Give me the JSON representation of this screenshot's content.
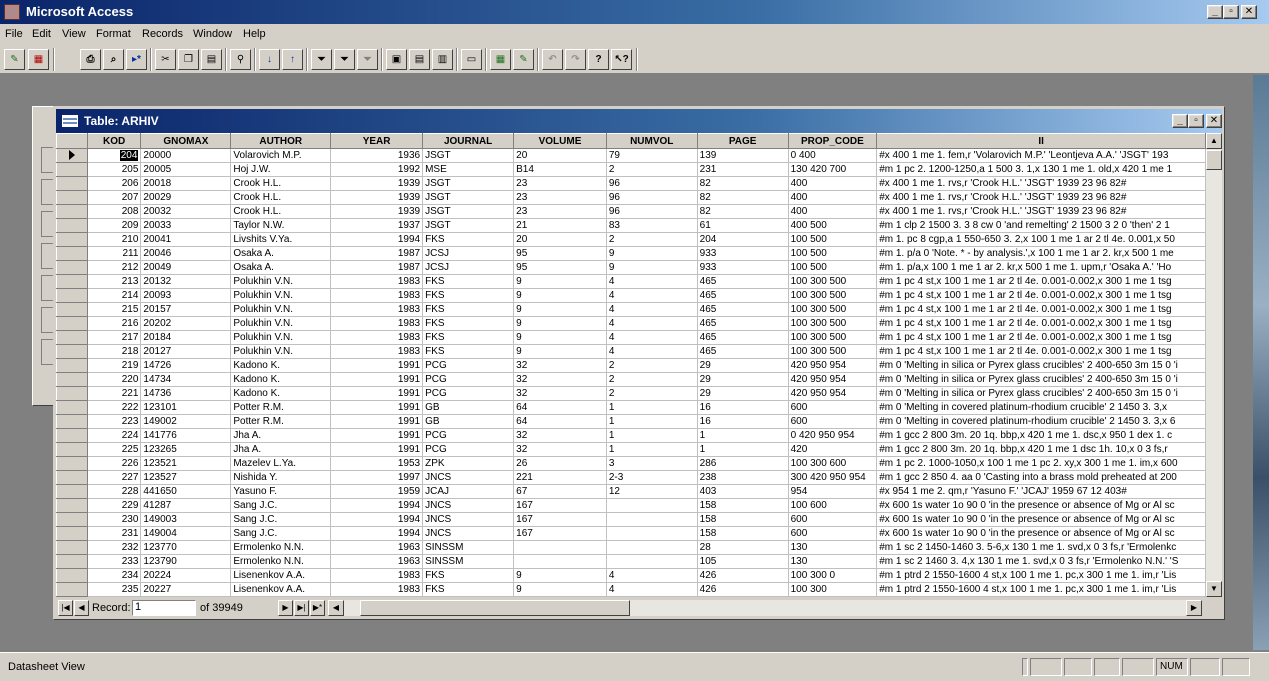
{
  "app": {
    "title": "Microsoft Access"
  },
  "menu": [
    "File",
    "Edit",
    "View",
    "Format",
    "Records",
    "Window",
    "Help"
  ],
  "toolbar_icons": [
    "design-view-icon",
    "datasheet-view-icon",
    "print-icon",
    "print-preview-icon",
    "spelling-icon",
    "cut-icon",
    "copy-icon",
    "paste-icon",
    "find-icon",
    "sort-ascending-icon",
    "sort-descending-icon",
    "filter-by-selection-icon",
    "filter-by-form-icon",
    "apply-filter-icon",
    "new-record-icon",
    "delete-record-icon",
    "properties-icon",
    "database-window-icon",
    "new-object-icon",
    "office-links-icon",
    "undo-icon",
    "help-icon",
    "whats-this-icon"
  ],
  "table_window": {
    "title": "Table: ARHIV",
    "columns": [
      "KOD",
      "GNOMAX",
      "AUTHOR",
      "YEAR",
      "JOURNAL",
      "VOLUME",
      "NUMVOL",
      "PAGE",
      "PROP_CODE",
      "II"
    ],
    "rows": [
      [
        "204",
        "20000",
        "Volarovich M.P.",
        "1936",
        "JSGT",
        "20",
        "79",
        "139",
        "0 400",
        "#x 400 1 me 1. fem,r 'Volarovich M.P.' 'Leontjeva A.A.'  'JSGT'  193"
      ],
      [
        "205",
        "20005",
        "Hoj J.W.",
        "1992",
        "MSE",
        "B14",
        "2",
        "231",
        "130 420 700",
        "#m 1 pc 2. 1200-1250,a 1 500 3. 1,x 130 1 me 1. old,x 420 1 me 1"
      ],
      [
        "206",
        "20018",
        "Crook H.L.",
        "1939",
        "JSGT",
        "23",
        "96",
        "82",
        "400",
        "#x 400 1 me 1. rvs,r 'Crook H.L.'  'JSGT'  1939 23 96 82#"
      ],
      [
        "207",
        "20029",
        "Crook H.L.",
        "1939",
        "JSGT",
        "23",
        "96",
        "82",
        "400",
        "#x 400 1 me 1. rvs,r 'Crook H.L.'  'JSGT'  1939 23 96 82#"
      ],
      [
        "208",
        "20032",
        "Crook H.L.",
        "1939",
        "JSGT",
        "23",
        "96",
        "82",
        "400",
        "#x 400 1 me 1. rvs,r 'Crook H.L.'  'JSGT'  1939 23 96 82#"
      ],
      [
        "209",
        "20033",
        "Taylor N.W.",
        "1937",
        "JSGT",
        "21",
        "83",
        "61",
        "400 500",
        "#m 1 clp 2 1500 3. 3 8 cw 0 'and remelting' 2 1500 3 2 0 'then' 2 1"
      ],
      [
        "210",
        "20041",
        "Livshits V.Ya.",
        "1994",
        "FKS",
        "20",
        "2",
        "204",
        "100 500",
        "#m 1. pc 8 cgp,a 1 550-650 3. 2,x 100 1 me 1 ar 2 tl 4e. 0.001,x 50"
      ],
      [
        "211",
        "20046",
        "Osaka A.",
        "1987",
        "JCSJ",
        "95",
        "9",
        "933",
        "100 500",
        "#m 1. p/a 0 'Note. * - by analysis.',x 100 1 me 1 ar 2. kr,x 500 1 me"
      ],
      [
        "212",
        "20049",
        "Osaka A.",
        "1987",
        "JCSJ",
        "95",
        "9",
        "933",
        "100 500",
        "#m 1. p/a,x 100 1 me 1 ar 2. kr,x 500 1 me 1. upm,r 'Osaka A.' 'Ho"
      ],
      [
        "213",
        "20132",
        "Polukhin V.N.",
        "1983",
        "FKS",
        "9",
        "4",
        "465",
        "100 300 500",
        "#m 1 pc 4 st,x 100 1 me 1 ar 2 tl 4e. 0.001-0.002,x 300 1 me 1 tsg"
      ],
      [
        "214",
        "20093",
        "Polukhin V.N.",
        "1983",
        "FKS",
        "9",
        "4",
        "465",
        "100 300 500",
        "#m 1 pc 4 st,x 100 1 me 1 ar 2 tl 4e. 0.001-0.002,x 300 1 me 1 tsg"
      ],
      [
        "215",
        "20157",
        "Polukhin V.N.",
        "1983",
        "FKS",
        "9",
        "4",
        "465",
        "100 300 500",
        "#m 1 pc 4 st,x 100 1 me 1 ar 2 tl 4e. 0.001-0.002,x 300 1 me 1 tsg"
      ],
      [
        "216",
        "20202",
        "Polukhin V.N.",
        "1983",
        "FKS",
        "9",
        "4",
        "465",
        "100 300 500",
        "#m 1 pc 4 st,x 100 1 me 1 ar 2 tl 4e. 0.001-0.002,x 300 1 me 1 tsg"
      ],
      [
        "217",
        "20184",
        "Polukhin V.N.",
        "1983",
        "FKS",
        "9",
        "4",
        "465",
        "100 300 500",
        "#m 1 pc 4 st,x 100 1 me 1 ar 2 tl 4e. 0.001-0.002,x 300 1 me 1 tsg"
      ],
      [
        "218",
        "20127",
        "Polukhin V.N.",
        "1983",
        "FKS",
        "9",
        "4",
        "465",
        "100 300 500",
        "#m 1 pc 4 st,x 100 1 me 1 ar 2 tl 4e. 0.001-0.002,x 300 1 me 1 tsg"
      ],
      [
        "219",
        "14726",
        "Kadono K.",
        "1991",
        "PCG",
        "32",
        "2",
        "29",
        "420 950 954",
        "#m 0 'Melting in silica or Pyrex glass crucibles' 2 400-650 3m 15 0 'i"
      ],
      [
        "220",
        "14734",
        "Kadono K.",
        "1991",
        "PCG",
        "32",
        "2",
        "29",
        "420 950 954",
        "#m 0 'Melting in silica or Pyrex glass crucibles' 2 400-650 3m 15 0 'i"
      ],
      [
        "221",
        "14736",
        "Kadono K.",
        "1991",
        "PCG",
        "32",
        "2",
        "29",
        "420 950 954",
        "#m 0 'Melting in silica or Pyrex glass crucibles' 2 400-650 3m 15 0 'i"
      ],
      [
        "222",
        "123101",
        "Potter R.M.",
        "1991",
        "GB",
        "64",
        "1",
        "16",
        "600",
        "#m 0 'Melting in covered platinum-rhodium crucible' 2 1450 3. 3,x"
      ],
      [
        "223",
        "149002",
        "Potter R.M.",
        "1991",
        "GB",
        "64",
        "1",
        "16",
        "600",
        "#m 0 'Melting in covered platinum-rhodium crucible' 2 1450 3. 3,x 6"
      ],
      [
        "224",
        "141776",
        "Jha A.",
        "1991",
        "PCG",
        "32",
        "1",
        "1",
        "0 420 950 954",
        "#m 1 gcc 2 800 3m. 20 1q. bbp,x 420 1 me 1.  dsc,x 950 1 dex 1. c"
      ],
      [
        "225",
        "123265",
        "Jha A.",
        "1991",
        "PCG",
        "32",
        "1",
        "1",
        "420",
        "#m 1 gcc 2 800 3m. 20 1q. bbp,x 420 1 me 1  dsc 1h. 10,x 0 3 fs,r"
      ],
      [
        "226",
        "123521",
        "Mazelev L.Ya.",
        "1953",
        "ZPK",
        "26",
        "3",
        "286",
        "100 300 600",
        "#m 1 pc 2. 1000-1050,x 100 1 me 1 pc 2. xy,x 300 1 me 1. im,x 600"
      ],
      [
        "227",
        "123527",
        "Nishida Y.",
        "1997",
        "JNCS",
        "221",
        "2-3",
        "238",
        "300 420 950 954",
        "#m 1 gcc 2 850 4. aa 0 'Casting into a brass mold preheated at 200"
      ],
      [
        "228",
        "441650",
        "Yasuno F.",
        "1959",
        "JCAJ",
        "67",
        "12",
        "403",
        "954",
        "#x 954 1 me 2. qm,r 'Yasuno F.'  'JCAJ'  1959 67 12 403#"
      ],
      [
        "229",
        "41287",
        "Sang J.C.",
        "1994",
        "JNCS",
        "167",
        "",
        "158",
        "100 600",
        "#x 600 1s water 1o 90 0 'in the presence or absence of Mg or Al sc"
      ],
      [
        "230",
        "149003",
        "Sang J.C.",
        "1994",
        "JNCS",
        "167",
        "",
        "158",
        "600",
        "#x 600 1s water 1o 90 0 'in the presence or absence of Mg or Al sc"
      ],
      [
        "231",
        "149004",
        "Sang J.C.",
        "1994",
        "JNCS",
        "167",
        "",
        "158",
        "600",
        "#x 600 1s water 1o 90 0 'in the presence or absence of Mg or Al sc"
      ],
      [
        "232",
        "123770",
        "Ermolenko N.N.",
        "1963",
        "SINSSM",
        "",
        "",
        "28",
        "130",
        "#m 1 sc 2 1450-1460 3. 5-6,x 130 1 me 1. svd,x 0 3 fs,r 'Ermolenkc"
      ],
      [
        "233",
        "123790",
        "Ermolenko N.N.",
        "1963",
        "SINSSM",
        "",
        "",
        "105",
        "130",
        "#m 1 sc 2 1460 3. 4,x 130 1 me 1. svd,x 0 3 fs,r 'Ermolenko N.N.' 'S"
      ],
      [
        "234",
        "20224",
        "Lisenenkov A.A.",
        "1983",
        "FKS",
        "9",
        "4",
        "426",
        "100 300 0",
        "#m 1 ptrd 2 1550-1600 4 st,x 100 1 me 1. pc,x 300 1 me 1. im,r 'Lis"
      ],
      [
        "235",
        "20227",
        "Lisenenkov A.A.",
        "1983",
        "FKS",
        "9",
        "4",
        "426",
        "100 300",
        "#m 1 ptrd 2 1550-1600 4 st,x 100 1 me 1. pc,x 300 1 me 1. im,r 'Lis"
      ]
    ]
  },
  "navigation": {
    "record_label": "Record:",
    "current_record": "1",
    "of_text": "of  39949"
  },
  "status": {
    "text": "Datasheet View",
    "num_indicator": "NUM"
  }
}
